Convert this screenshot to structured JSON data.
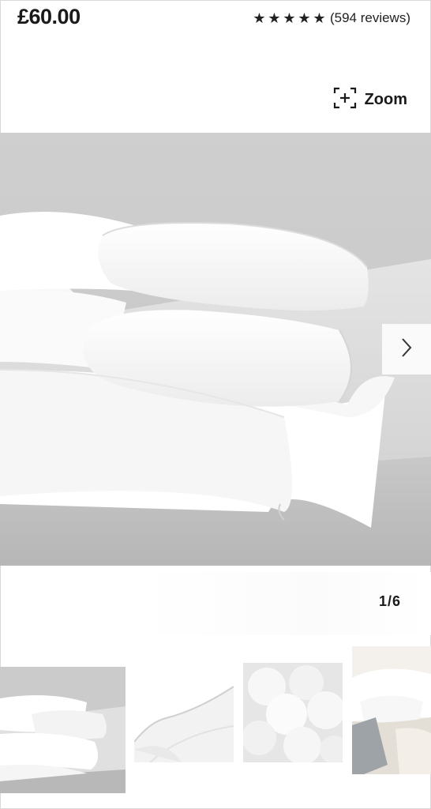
{
  "product": {
    "price": "£60.00",
    "rating_value": 5,
    "rating_max": 5,
    "reviews": "(594 reviews)"
  },
  "gallery": {
    "zoom_label": "Zoom",
    "counter": "1/6",
    "current": 1,
    "total": 6,
    "thumbnails": [
      {
        "name": "duvet-stack"
      },
      {
        "name": "duvet-corner"
      },
      {
        "name": "fibre-filling"
      },
      {
        "name": "bed-scene"
      }
    ]
  },
  "icons": {
    "star": "star-icon",
    "zoom": "zoom-icon",
    "next": "chevron-right-icon"
  },
  "colors": {
    "text": "#1a1a1a",
    "background": "#ffffff"
  }
}
